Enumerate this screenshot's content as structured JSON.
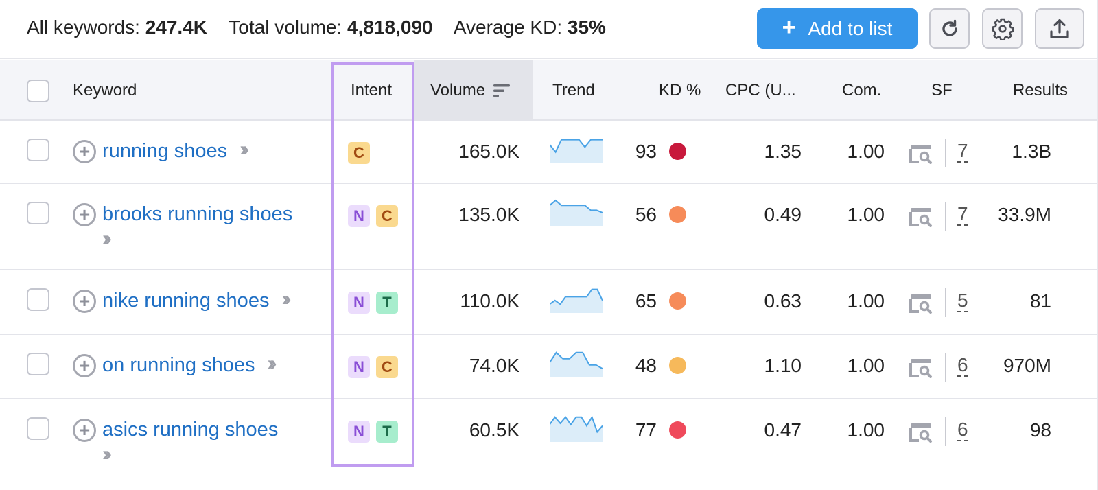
{
  "summary": {
    "all_keywords_label": "All keywords:",
    "all_keywords_value": "247.4K",
    "total_volume_label": "Total volume:",
    "total_volume_value": "4,818,090",
    "avg_kd_label": "Average KD:",
    "avg_kd_value": "35%"
  },
  "toolbar": {
    "add_to_list_label": "Add to list",
    "add_icon": "plus-icon",
    "refresh_icon": "refresh-icon",
    "settings_icon": "gear-icon",
    "export_icon": "export-icon"
  },
  "colors": {
    "accent": "#3696ea",
    "link": "#1f6fc4",
    "intent_highlight": "#c09cf0",
    "trend_line": "#4aa3e6",
    "trend_fill": "#dcedf9"
  },
  "table": {
    "columns": {
      "keyword": "Keyword",
      "intent": "Intent",
      "volume": "Volume",
      "trend": "Trend",
      "kd": "KD %",
      "cpc": "CPC (U...",
      "com": "Com.",
      "sf": "SF",
      "results": "Results"
    },
    "sorted_column": "volume",
    "rows": [
      {
        "keyword": "running shoes",
        "intents": [
          "C"
        ],
        "volume": "165.0K",
        "trend": [
          0.7,
          0.4,
          0.9,
          0.9,
          0.9,
          0.9,
          0.6,
          0.9,
          0.9,
          0.9
        ],
        "kd": "93",
        "kd_color": "#c8193c",
        "cpc": "1.35",
        "com": "1.00",
        "sf": "7",
        "results": "1.3B"
      },
      {
        "keyword": "brooks running shoes",
        "intents": [
          "N",
          "C"
        ],
        "volume": "135.0K",
        "trend": [
          0.8,
          1.0,
          0.8,
          0.8,
          0.8,
          0.8,
          0.8,
          0.6,
          0.6,
          0.5
        ],
        "kd": "56",
        "kd_color": "#f68b59",
        "cpc": "0.49",
        "com": "1.00",
        "sf": "7",
        "results": "33.9M"
      },
      {
        "keyword": "nike running shoes",
        "intents": [
          "N",
          "T"
        ],
        "volume": "110.0K",
        "trend": [
          0.3,
          0.45,
          0.3,
          0.6,
          0.6,
          0.6,
          0.6,
          0.6,
          0.9,
          0.9,
          0.45
        ],
        "kd": "65",
        "kd_color": "#f68b59",
        "cpc": "0.63",
        "com": "1.00",
        "sf": "5",
        "results": "81"
      },
      {
        "keyword": "on running shoes",
        "intents": [
          "N",
          "C"
        ],
        "volume": "74.0K",
        "trend": [
          0.55,
          0.95,
          0.7,
          0.7,
          0.95,
          0.95,
          0.45,
          0.45,
          0.3
        ],
        "kd": "48",
        "kd_color": "#f6b95b",
        "cpc": "1.10",
        "com": "1.00",
        "sf": "6",
        "results": "970M"
      },
      {
        "keyword": "asics running shoes",
        "intents": [
          "N",
          "T"
        ],
        "volume": "60.5K",
        "trend": [
          0.65,
          0.95,
          0.7,
          0.95,
          0.65,
          0.95,
          0.95,
          0.6,
          0.95,
          0.35,
          0.6
        ],
        "kd": "77",
        "kd_color": "#ef4a5b",
        "cpc": "0.47",
        "com": "1.00",
        "sf": "6",
        "results": "98"
      }
    ]
  }
}
